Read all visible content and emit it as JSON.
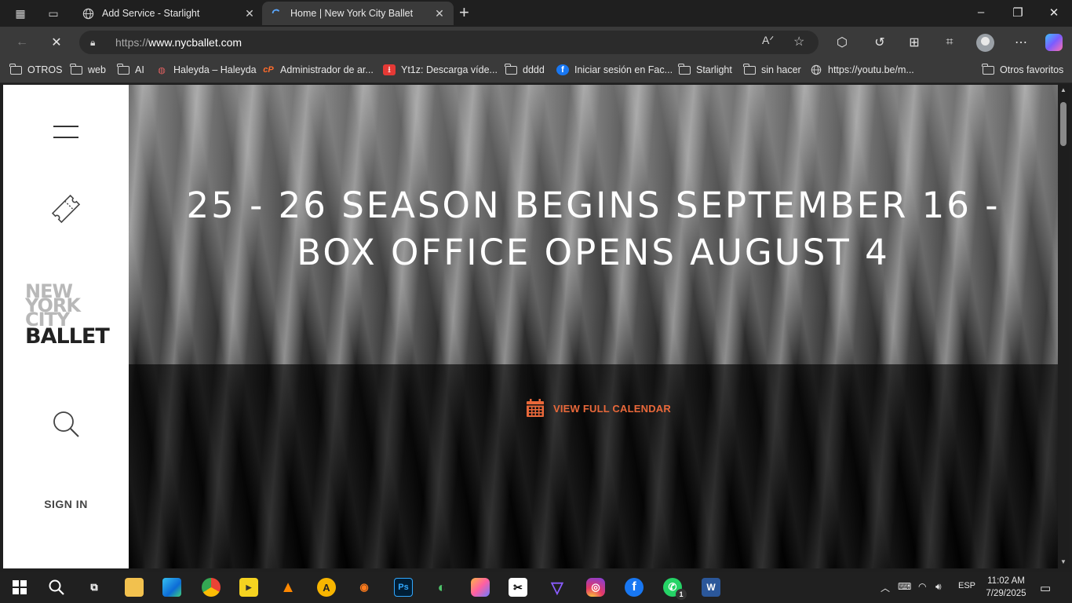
{
  "browser": {
    "tabs": [
      {
        "title": "Add Service - Starlight",
        "favicon": "globe-icon"
      },
      {
        "title": "Home | New York City Ballet",
        "favicon": "loading-spinner-icon",
        "active": true
      }
    ],
    "url_scheme": "https://",
    "url_host": "www.nycballet.com",
    "bookmarks": [
      {
        "label": "OTROS",
        "icon": "folder-icon"
      },
      {
        "label": "web",
        "icon": "folder-icon"
      },
      {
        "label": "AI",
        "icon": "folder-icon"
      },
      {
        "label": "Haleyda – Haleyda",
        "icon": "site-icon"
      },
      {
        "label": "Administrador de ar...",
        "icon": "cpanel-icon"
      },
      {
        "label": "Yt1z: Descarga víde...",
        "icon": "download-icon"
      },
      {
        "label": "dddd",
        "icon": "folder-icon"
      },
      {
        "label": "Iniciar sesión en Fac...",
        "icon": "facebook-icon"
      },
      {
        "label": "Starlight",
        "icon": "folder-icon"
      },
      {
        "label": "sin hacer",
        "icon": "folder-icon"
      },
      {
        "label": "https://youtu.be/m...",
        "icon": "globe-icon"
      }
    ],
    "other_favorites": "Otros favoritos"
  },
  "site": {
    "logo": {
      "line1": "NEW",
      "line2": "YORK",
      "line3": "CITY",
      "line4": "BALLET"
    },
    "sign_in": "SIGN IN",
    "hero_title_line1": "25 - 26 SEASON BEGINS SEPTEMBER 16 -",
    "hero_title_line2": "BOX OFFICE OPENS AUGUST 4",
    "calendar_link": "VIEW FULL CALENDAR",
    "accent_color": "#e9683a"
  },
  "taskbar": {
    "language": "ESP",
    "time": "11:02 AM",
    "date": "7/29/2025",
    "whatsapp_badge": "1"
  }
}
